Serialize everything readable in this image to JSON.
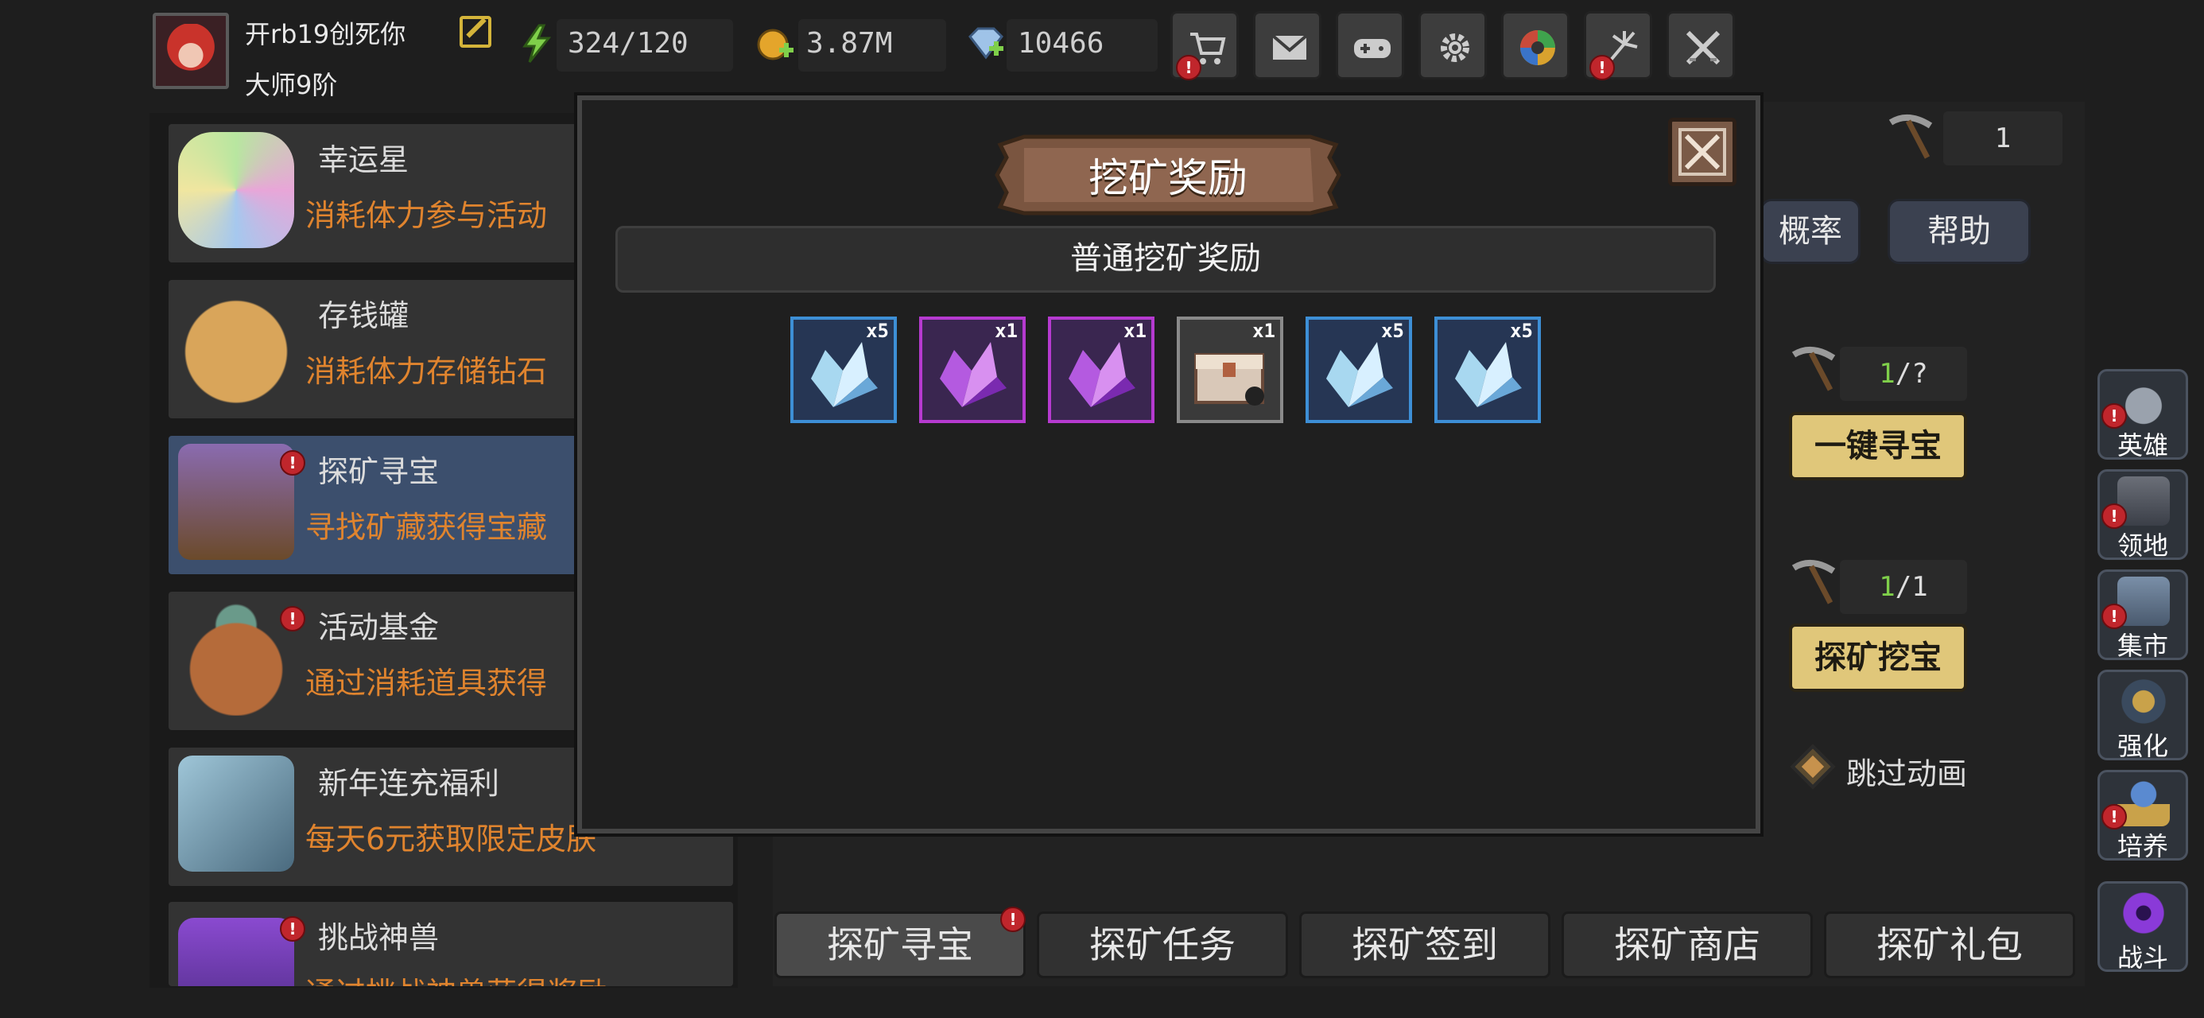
{
  "player": {
    "name": "开rb19创死你",
    "rank": "大师9阶"
  },
  "resources": {
    "energy": "324/120",
    "gold": "3.87M",
    "diamond": "10466"
  },
  "toolbar": [
    {
      "icon": "cart-icon",
      "alert": true
    },
    {
      "icon": "mail-icon",
      "alert": false
    },
    {
      "icon": "gamepad-icon",
      "alert": false
    },
    {
      "icon": "gear-icon",
      "alert": false
    },
    {
      "icon": "aperture-icon",
      "alert": false
    },
    {
      "icon": "fireworks-icon",
      "alert": true
    },
    {
      "icon": "swords-icon",
      "alert": false
    }
  ],
  "event_list": [
    {
      "title": "幸运星",
      "desc": "消耗体力参与活动",
      "icon": "lucky-star-icon",
      "alert": false
    },
    {
      "title": "存钱罐",
      "desc": "消耗体力存储钻石",
      "icon": "piggy-bank-icon",
      "alert": false
    },
    {
      "title": "探矿寻宝",
      "desc": "寻找矿藏获得宝藏",
      "icon": "treasure-chest-icon",
      "alert": true
    },
    {
      "title": "活动基金",
      "desc": "通过消耗道具获得",
      "icon": "money-bag-icon",
      "alert": true
    },
    {
      "title": "新年连充福利",
      "desc": "每天6元获取限定皮肤",
      "icon": "frozen-chest-icon",
      "alert": false
    },
    {
      "title": "挑战神兽",
      "desc": "通过挑战神兽获得奖励",
      "icon": "beast-icon",
      "alert": true
    }
  ],
  "right_panel": {
    "pickaxe_count": "1",
    "probability_btn": "概率",
    "help_btn": "帮助",
    "search_count_current": "1",
    "search_count_total": "/?",
    "one_click_btn": "一键寻宝",
    "dig_count_current": "1",
    "dig_count_total": "/1",
    "dig_btn": "探矿挖宝",
    "skip_anim_label": "跳过动画",
    "tabs": [
      "探矿寻宝",
      "探矿任务",
      "探矿签到",
      "探矿商店",
      "探矿礼包"
    ]
  },
  "side_nav": [
    {
      "label": "英雄",
      "icon": "helmet-icon",
      "alert": true
    },
    {
      "label": "领地",
      "icon": "castle-icon",
      "alert": true
    },
    {
      "label": "集市",
      "icon": "market-icon",
      "alert": true
    },
    {
      "label": "强化",
      "icon": "enhance-icon",
      "alert": false
    },
    {
      "label": "培养",
      "icon": "trophy-icon",
      "alert": true
    },
    {
      "label": "战斗",
      "icon": "portal-icon",
      "alert": false
    }
  ],
  "modal": {
    "title": "挖矿奖励",
    "subtitle": "普通挖矿奖励",
    "rewards": [
      {
        "item": "blue-crystal-icon",
        "qty": "x5",
        "rarity_color": "#3d8fd6"
      },
      {
        "item": "purple-crystal-icon",
        "qty": "x1",
        "rarity_color": "#b63ad0"
      },
      {
        "item": "purple-crystal-icon",
        "qty": "x1",
        "rarity_color": "#b63ad0"
      },
      {
        "item": "treasure-box-icon",
        "qty": "x1",
        "rarity_color": "#8a8a8a"
      },
      {
        "item": "blue-crystal-icon",
        "qty": "x5",
        "rarity_color": "#3d8fd6"
      },
      {
        "item": "blue-crystal-icon",
        "qty": "x5",
        "rarity_color": "#3d8fd6"
      }
    ]
  },
  "colors": {
    "accent_gold": "#e0c77a",
    "desc_orange": "#e0842e",
    "alert_red": "#c0262c"
  }
}
